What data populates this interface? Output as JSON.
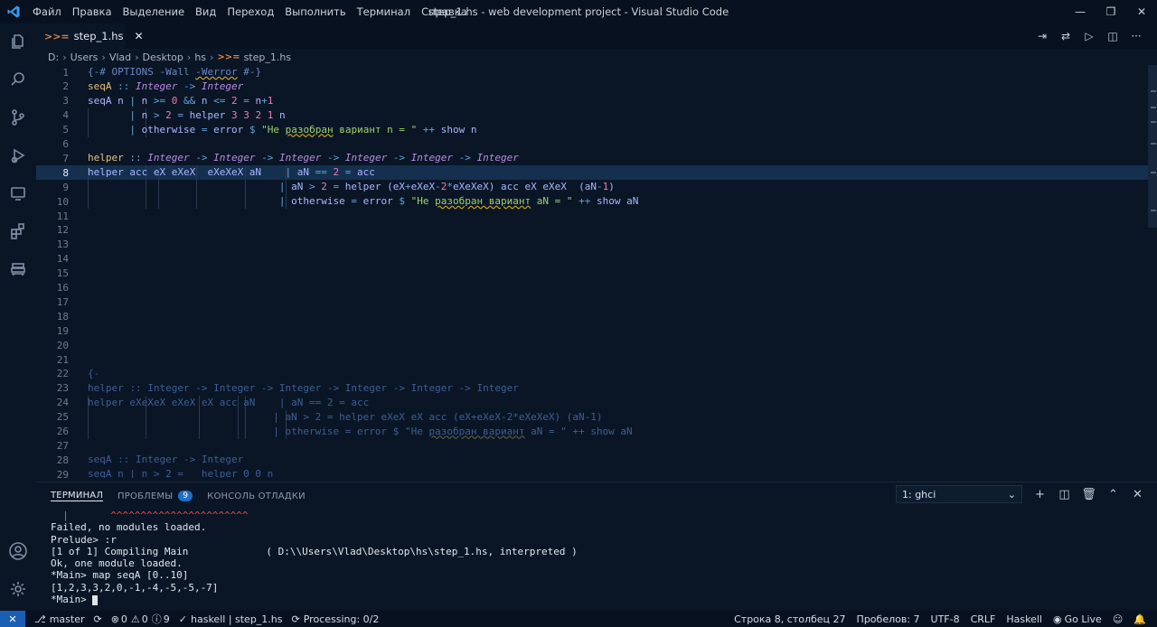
{
  "titlebar": {
    "menu": [
      "Файл",
      "Правка",
      "Выделение",
      "Вид",
      "Переход",
      "Выполнить",
      "Терминал",
      "Справка"
    ],
    "title": "step_1.hs - web development project - Visual Studio Code"
  },
  "tab": {
    "label": "step_1.hs"
  },
  "breadcrumb": [
    "D:",
    "Users",
    "Vlad",
    "Desktop",
    "hs",
    "step_1.hs"
  ],
  "editor": {
    "current_line": 8,
    "lines": [
      {
        "n": "1",
        "tokens": [
          [
            "{-# OPTIONS -Wall ",
            "t-com"
          ],
          [
            "-Werror",
            "t-com squig"
          ],
          [
            " #-}",
            "t-com"
          ]
        ]
      },
      {
        "n": "2",
        "tokens": [
          [
            "seqA",
            "t-fn"
          ],
          [
            " :: ",
            "t-op"
          ],
          [
            "Integer",
            "t-ty"
          ],
          [
            " -> ",
            "t-op"
          ],
          [
            "Integer",
            "t-ty"
          ]
        ]
      },
      {
        "n": "3",
        "tokens": [
          [
            "seqA n ",
            "t-var"
          ],
          [
            "| ",
            "t-op"
          ],
          [
            "n ",
            "t-var"
          ],
          [
            ">= ",
            "t-op"
          ],
          [
            "0",
            "t-num"
          ],
          [
            " && ",
            "t-op"
          ],
          [
            "n ",
            "t-var"
          ],
          [
            "<= ",
            "t-op"
          ],
          [
            "2",
            "t-num"
          ],
          [
            " = ",
            "t-op"
          ],
          [
            "n",
            "t-var"
          ],
          [
            "+",
            "t-op"
          ],
          [
            "1",
            "t-num"
          ]
        ]
      },
      {
        "n": "4",
        "tokens": [
          [
            "       ",
            ""
          ],
          [
            "| ",
            "t-op"
          ],
          [
            "n ",
            "t-var"
          ],
          [
            "> ",
            "t-op"
          ],
          [
            "2",
            "t-num"
          ],
          [
            " = ",
            "t-op"
          ],
          [
            "helper ",
            "t-var"
          ],
          [
            "3 3 2 1",
            "t-num"
          ],
          [
            " n",
            "t-var"
          ]
        ]
      },
      {
        "n": "5",
        "tokens": [
          [
            "       ",
            ""
          ],
          [
            "| ",
            "t-op"
          ],
          [
            "otherwise",
            "t-kw"
          ],
          [
            " = ",
            "t-op"
          ],
          [
            "error",
            "t-var"
          ],
          [
            " $ ",
            "t-op"
          ],
          [
            "\"Не ",
            "t-str"
          ],
          [
            "разобран",
            "t-str squig"
          ],
          [
            " вариант n = \"",
            "t-str"
          ],
          [
            " ++ ",
            "t-op"
          ],
          [
            "show n",
            "t-var"
          ]
        ]
      },
      {
        "n": "6",
        "tokens": []
      },
      {
        "n": "7",
        "tokens": [
          [
            "helper",
            "t-fn"
          ],
          [
            " :: ",
            "t-op"
          ],
          [
            "Integer",
            "t-ty"
          ],
          [
            " -> ",
            "t-op"
          ],
          [
            "Integer",
            "t-ty"
          ],
          [
            " -> ",
            "t-op"
          ],
          [
            "Integer",
            "t-ty"
          ],
          [
            " -> ",
            "t-op"
          ],
          [
            "Integer",
            "t-ty"
          ],
          [
            " -> ",
            "t-op"
          ],
          [
            "Integer",
            "t-ty"
          ],
          [
            " -> ",
            "t-op"
          ],
          [
            "Integer",
            "t-ty"
          ]
        ]
      },
      {
        "n": "8",
        "tokens": [
          [
            "helper acc eX eXeX  eXeXeX aN    ",
            "t-var"
          ],
          [
            "| ",
            "t-op"
          ],
          [
            "aN ",
            "t-var"
          ],
          [
            "== ",
            "t-op"
          ],
          [
            "2",
            "t-num"
          ],
          [
            " = ",
            "t-op"
          ],
          [
            "acc",
            "t-var"
          ]
        ]
      },
      {
        "n": "9",
        "tokens": [
          [
            "                                ",
            ""
          ],
          [
            "| ",
            "t-op"
          ],
          [
            "aN ",
            "t-var"
          ],
          [
            "> ",
            "t-op"
          ],
          [
            "2",
            "t-num"
          ],
          [
            " = ",
            "t-op"
          ],
          [
            "helper (eX",
            "t-var"
          ],
          [
            "+",
            "t-op"
          ],
          [
            "eXeX",
            "t-var"
          ],
          [
            "-",
            "t-op"
          ],
          [
            "2",
            "t-num"
          ],
          [
            "*",
            "t-op"
          ],
          [
            "eXeXeX) acc eX eXeX  (aN",
            "t-var"
          ],
          [
            "-",
            "t-op"
          ],
          [
            "1",
            "t-num"
          ],
          [
            ")",
            "t-var"
          ]
        ]
      },
      {
        "n": "10",
        "tokens": [
          [
            "                                ",
            ""
          ],
          [
            "| ",
            "t-op"
          ],
          [
            "otherwise",
            "t-kw"
          ],
          [
            " = ",
            "t-op"
          ],
          [
            "error",
            "t-var"
          ],
          [
            " $ ",
            "t-op"
          ],
          [
            "\"Не ",
            "t-str"
          ],
          [
            "разобран вариант",
            "t-str squig"
          ],
          [
            " aN = \"",
            "t-str"
          ],
          [
            " ++ ",
            "t-op"
          ],
          [
            "show aN",
            "t-var"
          ]
        ]
      },
      {
        "n": "11",
        "tokens": []
      },
      {
        "n": "12",
        "tokens": []
      },
      {
        "n": "13",
        "tokens": []
      },
      {
        "n": "14",
        "tokens": []
      },
      {
        "n": "15",
        "tokens": []
      },
      {
        "n": "16",
        "tokens": []
      },
      {
        "n": "17",
        "tokens": []
      },
      {
        "n": "18",
        "tokens": []
      },
      {
        "n": "19",
        "tokens": []
      },
      {
        "n": "20",
        "tokens": []
      },
      {
        "n": "21",
        "tokens": []
      },
      {
        "n": "22",
        "tokens": [
          [
            "{-",
            "t-fade"
          ]
        ]
      },
      {
        "n": "23",
        "tokens": [
          [
            "helper :: Integer -> Integer -> Integer -> Integer -> Integer -> Integer",
            "t-fade"
          ]
        ]
      },
      {
        "n": "24",
        "tokens": [
          [
            "helper eXeXeX eXeX eX acc aN    | aN == 2 = acc",
            "t-fade"
          ]
        ]
      },
      {
        "n": "25",
        "tokens": [
          [
            "                               | aN > 2 = helper eXeX eX acc (eX+eXeX-2*eXeXeX) (aN-1)",
            "t-fade"
          ]
        ]
      },
      {
        "n": "26",
        "tokens": [
          [
            "                               | otherwise = error $ \"Не ",
            "t-fade"
          ],
          [
            "разобран вариант",
            "t-fade squig-fade"
          ],
          [
            " aN = \" ++ show aN",
            "t-fade"
          ]
        ]
      },
      {
        "n": "27",
        "tokens": []
      },
      {
        "n": "28",
        "tokens": [
          [
            "seqA :: Integer -> Integer",
            "t-fade"
          ]
        ]
      },
      {
        "n": "29",
        "tokens": [
          [
            "seqA n | n > 2 =   helper 0 0 n",
            "t-fade"
          ]
        ]
      }
    ]
  },
  "panel": {
    "tabs": [
      "ТЕРМИНАЛ",
      "ПРОБЛЕМЫ",
      "КОНСОЛЬ ОТЛАДКИ"
    ],
    "problems_count": "9",
    "terminal_select": "1: ghci",
    "terminal_lines": [
      "  |       ^^^^^^^^^^^^^^^^^^^^^^^",
      "Failed, no modules loaded.",
      "Prelude> :r",
      "[1 of 1] Compiling Main             ( D:\\\\Users\\Vlad\\Desktop\\hs\\step_1.hs, interpreted )",
      "Ok, one module loaded.",
      "*Main> map seqA [0..10]",
      "[1,2,3,3,2,0,-1,-4,-5,-5,-7]",
      "*Main> "
    ]
  },
  "statusbar": {
    "branch": "master",
    "errors": "0",
    "warnings": "0",
    "info": "9",
    "haskell": "haskell | step_1.hs",
    "processing": "Processing: 0/2",
    "position": "Строка 8, столбец 27",
    "spaces": "Пробелов: 7",
    "encoding": "UTF-8",
    "eol": "CRLF",
    "language": "Haskell",
    "golive": "Go Live"
  }
}
